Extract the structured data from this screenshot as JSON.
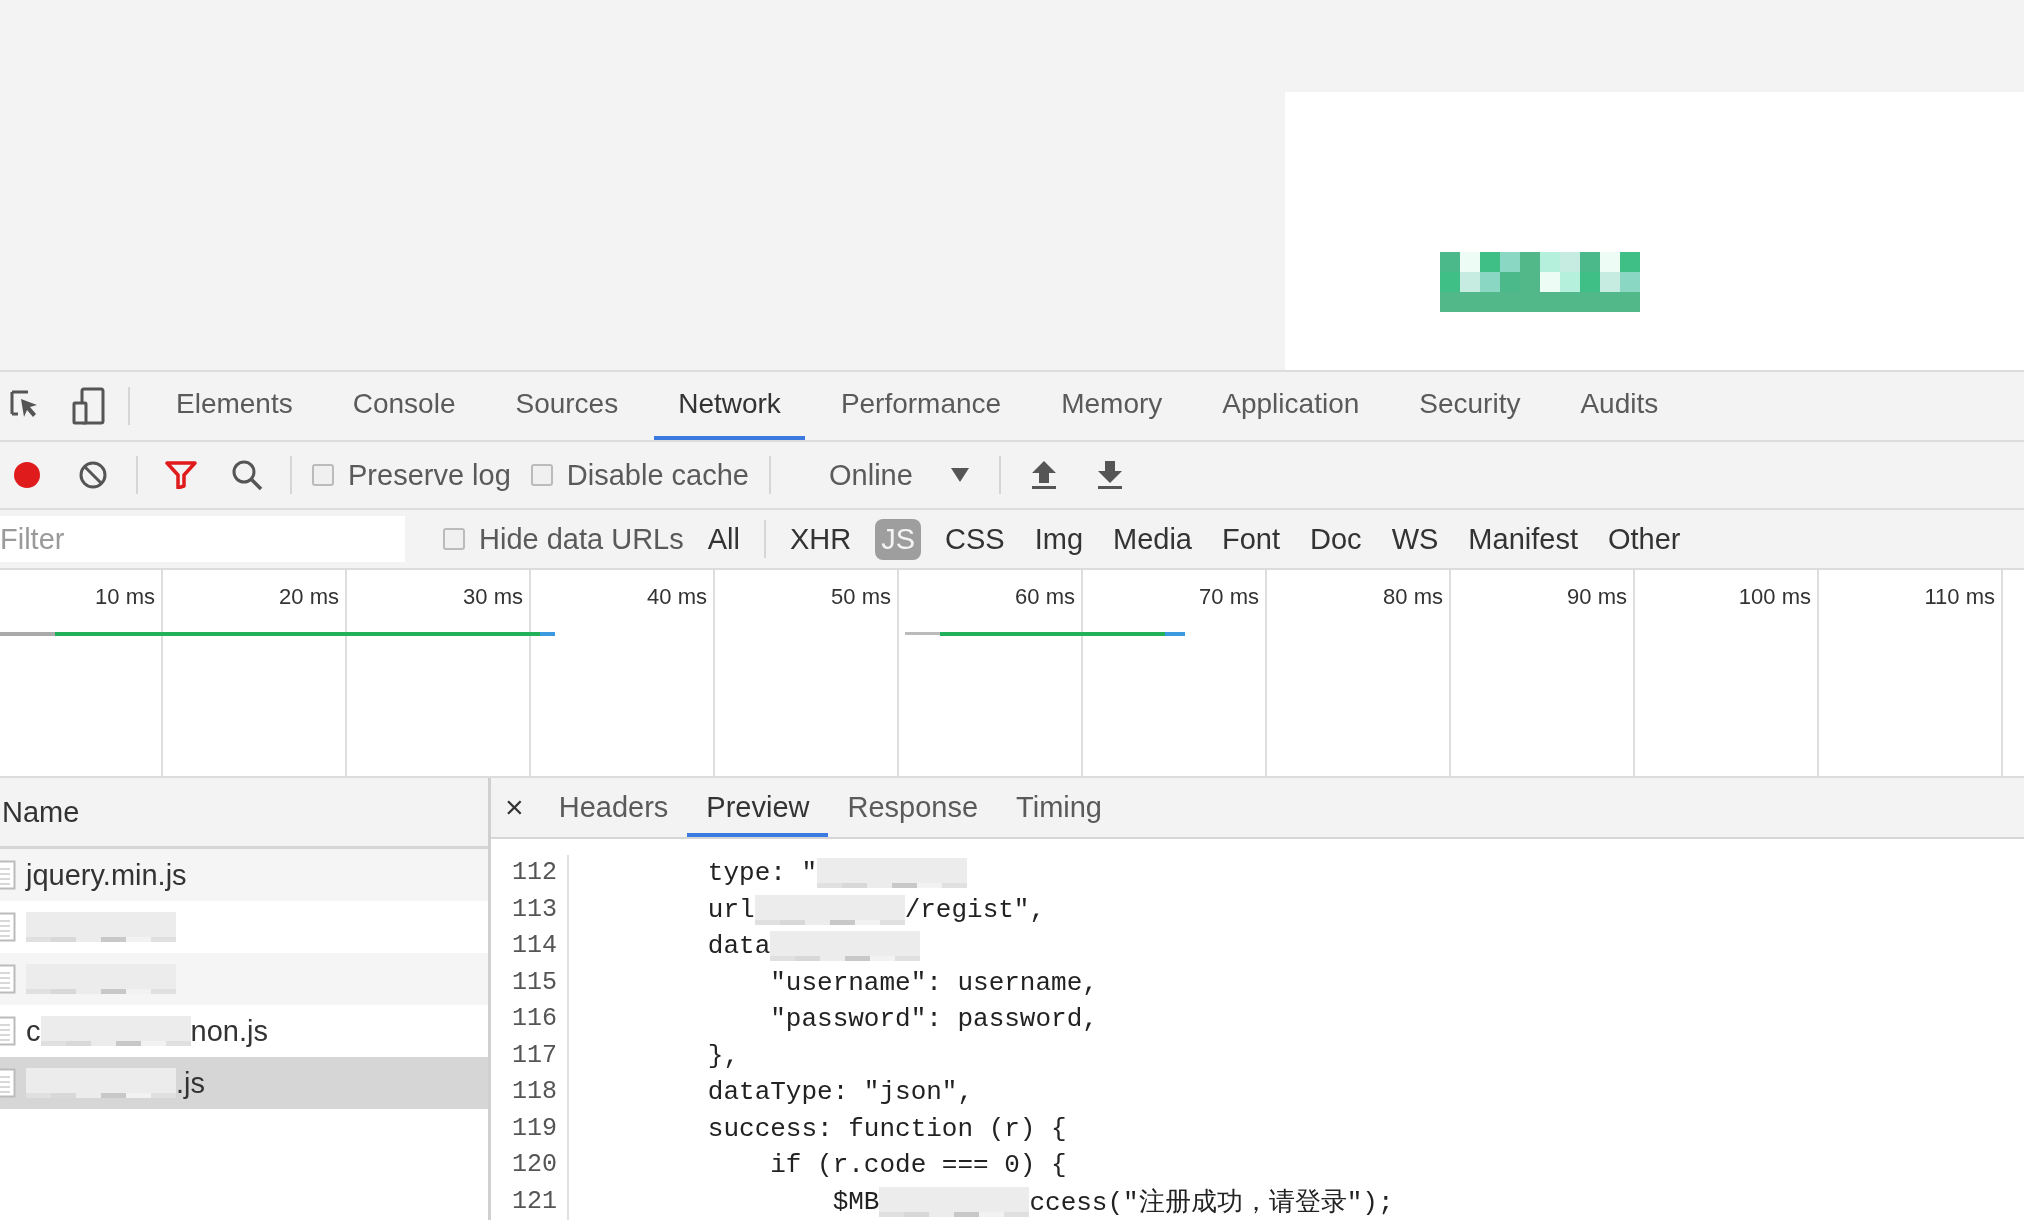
{
  "page": {
    "picture": {
      "kind": "mosaic"
    }
  },
  "devtools": {
    "tabs": [
      {
        "label": "Elements",
        "selected": false
      },
      {
        "label": "Console",
        "selected": false
      },
      {
        "label": "Sources",
        "selected": false
      },
      {
        "label": "Network",
        "selected": true
      },
      {
        "label": "Performance",
        "selected": false
      },
      {
        "label": "Memory",
        "selected": false
      },
      {
        "label": "Application",
        "selected": false
      },
      {
        "label": "Security",
        "selected": false
      },
      {
        "label": "Audits",
        "selected": false
      }
    ],
    "toolbar": {
      "recording": true,
      "filter_shown": true,
      "preserve_log": {
        "label": "Preserve log",
        "checked": false
      },
      "disable_cache": {
        "label": "Disable cache",
        "checked": false
      },
      "throttling": "Online"
    },
    "filter_bar": {
      "placeholder": "Filter",
      "hide_data_urls": {
        "label": "Hide data URLs",
        "checked": false
      },
      "types": [
        {
          "label": "All",
          "selected": false
        },
        {
          "label": "XHR",
          "selected": false
        },
        {
          "label": "JS",
          "selected": true
        },
        {
          "label": "CSS",
          "selected": false
        },
        {
          "label": "Img",
          "selected": false
        },
        {
          "label": "Media",
          "selected": false
        },
        {
          "label": "Font",
          "selected": false
        },
        {
          "label": "Doc",
          "selected": false
        },
        {
          "label": "WS",
          "selected": false
        },
        {
          "label": "Manifest",
          "selected": false
        },
        {
          "label": "Other",
          "selected": false
        }
      ]
    },
    "overview": {
      "ticks": [
        "10 ms",
        "20 ms",
        "30 ms",
        "40 ms",
        "50 ms",
        "60 ms",
        "70 ms",
        "80 ms",
        "90 ms",
        "100 ms",
        "110 ms"
      ]
    },
    "requests": {
      "header": "Name",
      "rows": [
        {
          "selected": false,
          "parts": [
            {
              "kind": "text",
              "text": "jquery.min.js"
            }
          ]
        },
        {
          "selected": false,
          "parts": [
            {
              "kind": "redacted"
            }
          ]
        },
        {
          "selected": false,
          "parts": [
            {
              "kind": "redacted"
            }
          ]
        },
        {
          "selected": false,
          "parts": [
            {
              "kind": "text",
              "text": "c"
            },
            {
              "kind": "redacted"
            },
            {
              "kind": "text",
              "text": "non.js"
            }
          ]
        },
        {
          "selected": true,
          "parts": [
            {
              "kind": "redacted"
            },
            {
              "kind": "text",
              "text": ".js"
            }
          ]
        }
      ]
    },
    "detail": {
      "close": "×",
      "tabs": [
        {
          "label": "Headers",
          "selected": false
        },
        {
          "label": "Preview",
          "selected": true
        },
        {
          "label": "Response",
          "selected": false
        },
        {
          "label": "Timing",
          "selected": false
        }
      ],
      "lines": [
        {
          "number": "112",
          "parts": [
            {
              "kind": "text",
              "text": "        type: \""
            },
            {
              "kind": "redacted"
            }
          ]
        },
        {
          "number": "113",
          "parts": [
            {
              "kind": "text",
              "text": "        url"
            },
            {
              "kind": "redacted"
            },
            {
              "kind": "text",
              "text": "/regist\","
            }
          ]
        },
        {
          "number": "114",
          "parts": [
            {
              "kind": "text",
              "text": "        data"
            },
            {
              "kind": "redacted"
            }
          ]
        },
        {
          "number": "115",
          "parts": [
            {
              "kind": "text",
              "text": "            \"username\": username,"
            }
          ]
        },
        {
          "number": "116",
          "parts": [
            {
              "kind": "text",
              "text": "            \"password\": password,"
            }
          ]
        },
        {
          "number": "117",
          "parts": [
            {
              "kind": "text",
              "text": "        },"
            }
          ]
        },
        {
          "number": "118",
          "parts": [
            {
              "kind": "text",
              "text": "        dataType: \"json\","
            }
          ]
        },
        {
          "number": "119",
          "parts": [
            {
              "kind": "text",
              "text": "        success: function (r) {"
            }
          ]
        },
        {
          "number": "120",
          "parts": [
            {
              "kind": "text",
              "text": "            if (r.code === 0) {"
            }
          ]
        },
        {
          "number": "121",
          "parts": [
            {
              "kind": "text",
              "text": "                $MB"
            },
            {
              "kind": "redacted"
            },
            {
              "kind": "text",
              "text": "ccess(\"注册成功，请登录\");"
            }
          ]
        }
      ]
    }
  }
}
